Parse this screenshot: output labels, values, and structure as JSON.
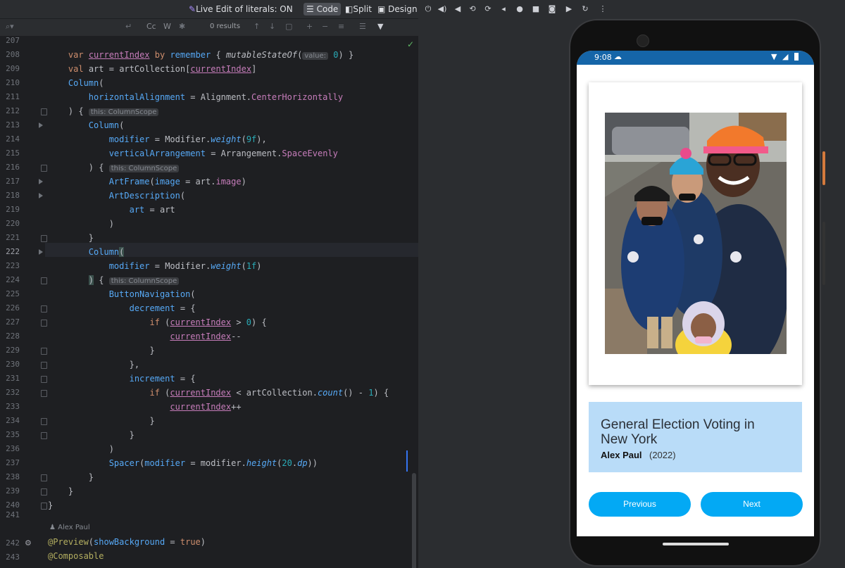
{
  "toolbar": {
    "live_edit": "Live Edit of literals: ON",
    "code": "Code",
    "split": "Split",
    "design": "Design"
  },
  "search": {
    "results": "0 results",
    "cc": "Cc",
    "w": "W"
  },
  "editor": {
    "line_numbers": [
      "207",
      "208",
      "209",
      "210",
      "211",
      "212",
      "213",
      "214",
      "215",
      "216",
      "217",
      "218",
      "219",
      "220",
      "221",
      "222",
      "223",
      "224",
      "225",
      "226",
      "227",
      "228",
      "229",
      "230",
      "231",
      "232",
      "233",
      "234",
      "235",
      "236",
      "237",
      "238",
      "239",
      "240",
      "241",
      "242",
      "243"
    ],
    "hint_column_scope": "this: ColumnScope",
    "hint_value": "value:",
    "author": "Alex Paul",
    "t": {
      "var": "var",
      "val": "val",
      "by": "by",
      "if": "if",
      "currentIndex": "currentIndex",
      "remember": "remember",
      "ob": "{",
      "cb": "}",
      "mutableStateOf": "mutableStateOf",
      "zero": "0",
      "one": "1",
      "art": "art",
      "eq": " = ",
      "artCollection": "artCollection",
      "Column": "Column",
      "horizontalAlignment": "horizontalAlignment",
      "Alignment": "Alignment",
      "CenterHorizontally": "CenterHorizontally",
      "modifier": "modifier",
      "Modifier": "Modifier",
      "weight": "weight",
      "nine_f": "9f",
      "one_f": "1f",
      "verticalArrangement": "verticalArrangement",
      "Arrangement": "Arrangement",
      "SpaceEvenly": "SpaceEvenly",
      "ArtFrame": "ArtFrame",
      "image": "image",
      "ArtDescription": "ArtDescription",
      "ButtonNavigation": "ButtonNavigation",
      "decrement": "decrement",
      "increment": "increment",
      "count": "count",
      "Spacer": "Spacer",
      "height": "height",
      "twenty": "20",
      "dp": "dp",
      "Preview": "@Preview",
      "showBackground": "showBackground",
      "true": "true",
      "Composable": "@Composable"
    }
  },
  "device": {
    "time": "9:08",
    "art_title": "General Election Voting in New York",
    "artist": "Alex Paul",
    "year": "(2022)",
    "prev_label": "Previous",
    "next_label": "Next"
  },
  "colors": {
    "status_bar": "#1565a8",
    "button": "#03a9f4",
    "description_bg": "#b9dcf8",
    "editor_bg": "#1e1f22"
  }
}
